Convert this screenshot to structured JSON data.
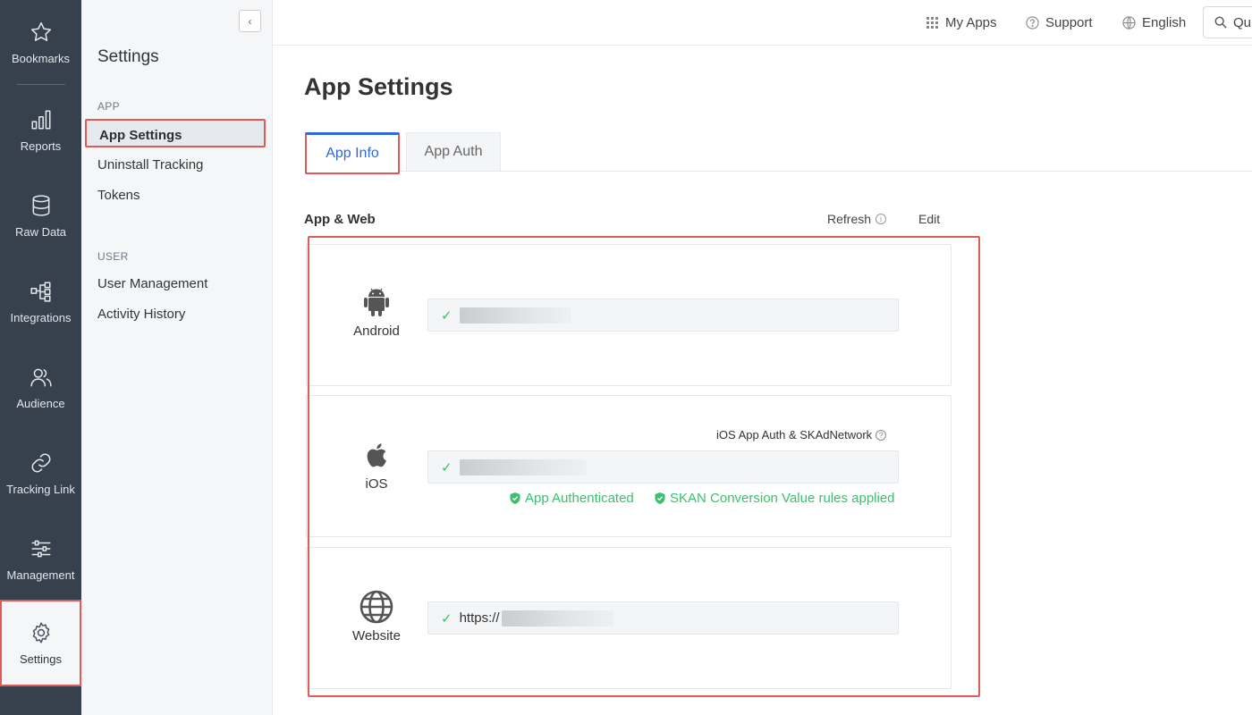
{
  "rail": {
    "items": [
      {
        "label": "Bookmarks",
        "icon": "star-icon"
      },
      {
        "label": "Reports",
        "icon": "bar-chart-icon"
      },
      {
        "label": "Raw Data",
        "icon": "database-icon"
      },
      {
        "label": "Integrations",
        "icon": "integrations-icon"
      },
      {
        "label": "Audience",
        "icon": "audience-icon"
      },
      {
        "label": "Tracking Link",
        "icon": "link-icon"
      },
      {
        "label": "Management",
        "icon": "sliders-icon"
      },
      {
        "label": "Settings",
        "icon": "gear-icon"
      }
    ],
    "active": "Settings"
  },
  "sidebar": {
    "title": "Settings",
    "sections": [
      {
        "heading": "APP",
        "links": [
          "App Settings",
          "Uninstall Tracking",
          "Tokens"
        ]
      },
      {
        "heading": "USER",
        "links": [
          "User Management",
          "Activity History"
        ]
      }
    ],
    "active_link": "App Settings"
  },
  "topbar": {
    "my_apps": "My Apps",
    "support": "Support",
    "language": "English",
    "quick_search": "Qu"
  },
  "main": {
    "title": "App Settings",
    "tabs": [
      {
        "label": "App Info",
        "active": true
      },
      {
        "label": "App Auth",
        "active": false
      }
    ],
    "section_title": "App & Web",
    "refresh_label": "Refresh",
    "edit_label": "Edit",
    "platforms": {
      "android": {
        "label": "Android"
      },
      "ios": {
        "label": "iOS",
        "meta_link": "iOS App Auth & SKAdNetwork",
        "status_1": "App Authenticated",
        "status_2": "SKAN Conversion Value rules applied"
      },
      "website": {
        "label": "Website",
        "value_prefix": "https://"
      }
    }
  },
  "colors": {
    "rail_bg": "#36414d",
    "accent_blue": "#3267d6",
    "success_green": "#3cbf6e",
    "highlight_red": "#e05a5a"
  }
}
